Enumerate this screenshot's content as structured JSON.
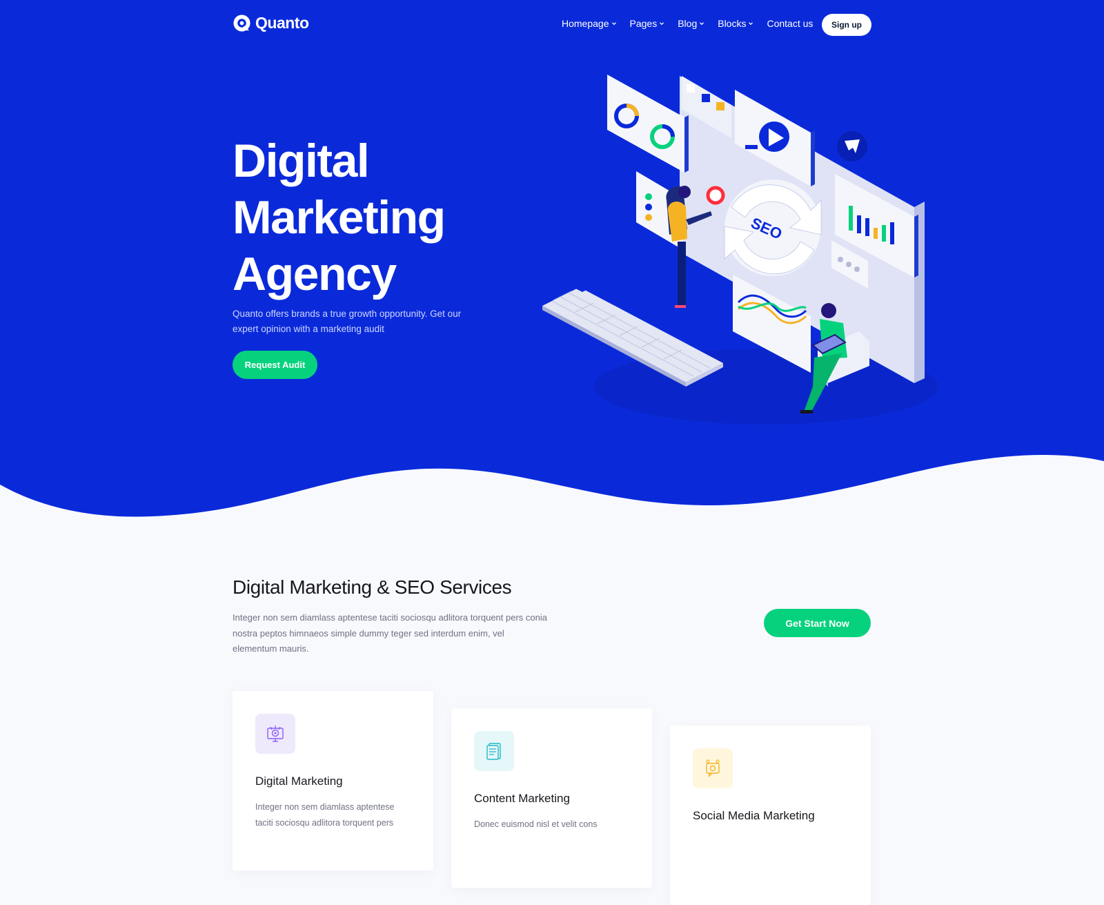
{
  "brand": {
    "name": "Quanto",
    "logo_icon": "q-logo-icon"
  },
  "nav": {
    "items": [
      {
        "label": "Homepage",
        "has_dropdown": true
      },
      {
        "label": "Pages",
        "has_dropdown": true
      },
      {
        "label": "Blog",
        "has_dropdown": true
      },
      {
        "label": "Blocks",
        "has_dropdown": true
      },
      {
        "label": "Contact us",
        "has_dropdown": false
      }
    ],
    "signup_label": "Sign up"
  },
  "hero": {
    "title_lines": [
      "Digital",
      "Marketing",
      "Agency"
    ],
    "subtitle": "Quanto offers brands a true growth opportunity. Get our expert opinion with a marketing audit",
    "cta_label": "Request Audit",
    "illustration_seo_label": "SEO"
  },
  "services": {
    "title": "Digital Marketing & SEO Services",
    "description": "Integer non sem diamlass aptentese taciti sociosqu adlitora torquent pers conia nostra peptos himnaeos simple dummy teger sed interdum enim, vel elementum mauris.",
    "cta_label": "Get Start Now",
    "cards": [
      {
        "title": "Digital Marketing",
        "text": "Integer non sem diamlass aptentese taciti sociosqu adlitora torquent pers",
        "icon": "monitor-target-icon",
        "icon_bg": "#efe9fc",
        "icon_color": "#8a5cf6"
      },
      {
        "title": "Content Marketing",
        "text": "Donec euismod nisl et velit cons",
        "icon": "document-icon",
        "icon_bg": "#e5f7f8",
        "icon_color": "#1fb9c7"
      },
      {
        "title": "Social Media Marketing",
        "text": "",
        "icon": "social-media-icon",
        "icon_bg": "#fff6dd",
        "icon_color": "#f5b324"
      }
    ]
  },
  "colors": {
    "hero_blue": "#0a2ada",
    "accent_green": "#06d27e",
    "page_bg": "#f8f9fd"
  }
}
